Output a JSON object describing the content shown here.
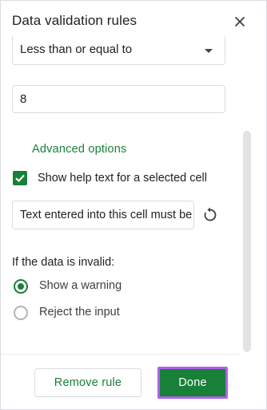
{
  "dialog": {
    "title": "Data validation rules"
  },
  "criteria": {
    "selected": "Less than or equal to"
  },
  "value": {
    "text": "8"
  },
  "advanced": {
    "label": "Advanced options",
    "help_checkbox_label": "Show help text for a selected cell",
    "help_checked": true,
    "help_text_value": "Text entered into this cell must be"
  },
  "invalid": {
    "heading": "If the data is invalid:",
    "options": [
      {
        "label": "Show a warning",
        "selected": true
      },
      {
        "label": "Reject the input",
        "selected": false
      }
    ]
  },
  "footer": {
    "remove_label": "Remove rule",
    "done_label": "Done"
  },
  "colors": {
    "accent": "#188038",
    "highlight": "#b061e8"
  }
}
